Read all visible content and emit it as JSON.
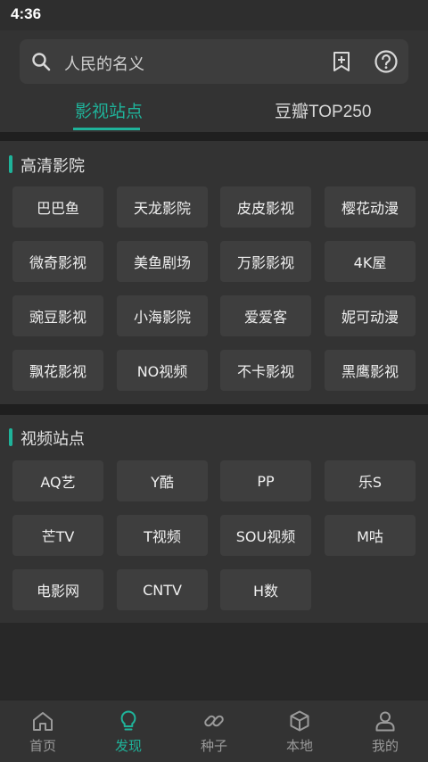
{
  "status": {
    "time": "4:36"
  },
  "search": {
    "query": "人民的名义"
  },
  "tabs": [
    {
      "label": "影视站点",
      "active": true
    },
    {
      "label": "豆瓣TOP250",
      "active": false
    }
  ],
  "sections": [
    {
      "title": "高清影院",
      "items": [
        "巴巴鱼",
        "天龙影院",
        "皮皮影视",
        "樱花动漫",
        "微奇影视",
        "美鱼剧场",
        "万影影视",
        "4K屋",
        "豌豆影视",
        "小海影院",
        "爱爱客",
        "妮可动漫",
        "飘花影视",
        "NO视频",
        "不卡影视",
        "黑鹰影视"
      ]
    },
    {
      "title": "视频站点",
      "items": [
        "AQ艺",
        "Y酷",
        "PP",
        "乐S",
        "芒TV",
        "T视频",
        "SOU视频",
        "M咕",
        "电影网",
        "CNTV",
        "H数"
      ]
    }
  ],
  "bottom_nav": [
    {
      "label": "首页",
      "icon": "home-icon",
      "active": false
    },
    {
      "label": "发现",
      "icon": "lightbulb-icon",
      "active": true
    },
    {
      "label": "种子",
      "icon": "link-icon",
      "active": false
    },
    {
      "label": "本地",
      "icon": "cube-icon",
      "active": false
    },
    {
      "label": "我的",
      "icon": "person-icon",
      "active": false
    }
  ],
  "colors": {
    "accent": "#1fb39a",
    "background": "#282828",
    "panel": "#333333",
    "cell": "#3e3e3e"
  }
}
